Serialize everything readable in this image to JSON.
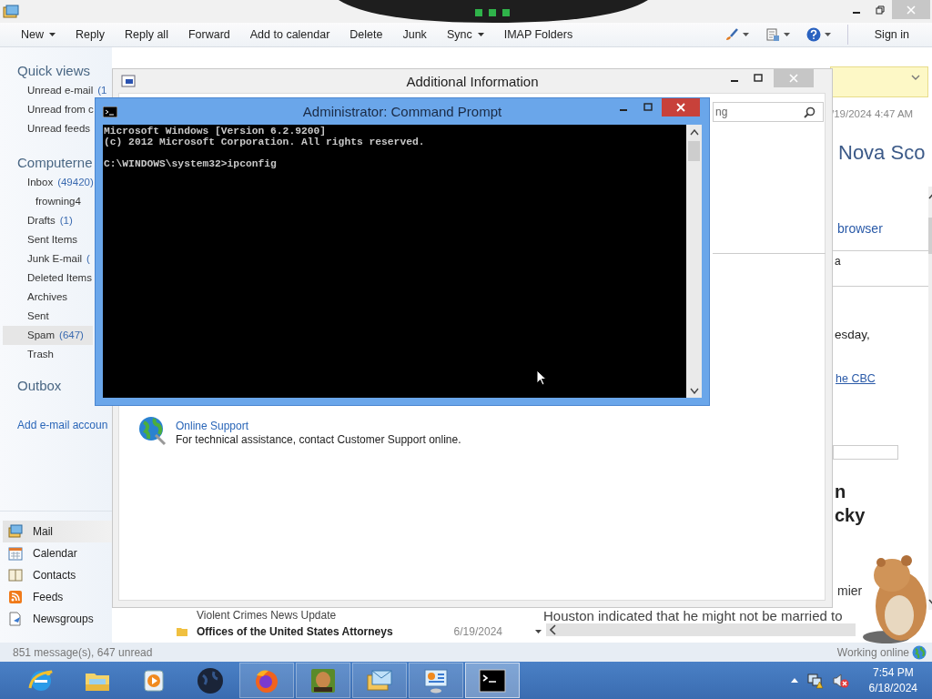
{
  "mail_window": {
    "toolbar": [
      {
        "label": "New",
        "dropdown": true
      },
      {
        "label": "Reply",
        "dropdown": false
      },
      {
        "label": "Reply all",
        "dropdown": false
      },
      {
        "label": "Forward",
        "dropdown": false
      },
      {
        "label": "Add to calendar",
        "dropdown": false
      },
      {
        "label": "Delete",
        "dropdown": false
      },
      {
        "label": "Junk",
        "dropdown": false
      },
      {
        "label": "Sync",
        "dropdown": true
      },
      {
        "label": "IMAP Folders",
        "dropdown": false
      }
    ],
    "toolbar_tools": [
      {
        "kind": "brush"
      },
      {
        "kind": "layout"
      },
      {
        "kind": "help"
      }
    ],
    "sign_in": "Sign in",
    "sidebar": {
      "quick_views": {
        "title": "Quick views",
        "items": [
          {
            "label": "Unread e-mail",
            "count": "(1"
          },
          {
            "label": "Unread from c"
          },
          {
            "label": "Unread feeds"
          }
        ]
      },
      "account": {
        "title": "Computerne",
        "folders": [
          {
            "label": "Inbox",
            "count": "(49420)",
            "selected": false,
            "children": [
              {
                "label": "frowning4",
                "selected": false
              }
            ]
          },
          {
            "label": "Drafts",
            "count": "(1)",
            "selected": false
          },
          {
            "label": "Sent Items",
            "selected": false
          },
          {
            "label": "Junk E-mail",
            "count": "(",
            "selected": false
          },
          {
            "label": "Deleted Items",
            "selected": false
          },
          {
            "label": "Archives",
            "selected": false
          },
          {
            "label": "Sent",
            "selected": false
          },
          {
            "label": "Spam",
            "count": "(647)",
            "selected": true
          },
          {
            "label": "Trash",
            "selected": false
          }
        ]
      },
      "outbox": "Outbox",
      "add_account": "Add e-mail accoun"
    },
    "nav": [
      {
        "kind": "mail",
        "label": "Mail",
        "selected": true
      },
      {
        "kind": "calendar",
        "label": "Calendar",
        "selected": false
      },
      {
        "kind": "contacts",
        "label": "Contacts",
        "selected": false
      },
      {
        "kind": "feeds",
        "label": "Feeds",
        "selected": false
      },
      {
        "kind": "newsgroups",
        "label": "Newsgroups",
        "selected": false
      }
    ],
    "message_list": {
      "preview_line": "Violent Crimes News Update",
      "next_message": {
        "sender": "Offices of the United States Attorneys",
        "date": "6/19/2024"
      }
    },
    "reading_pane": {
      "date": "/19/2024 4:47 AM",
      "title": "Nova Sco",
      "link": "browser",
      "line_1": "a",
      "line_2": "esday,",
      "link_2": "he CBC",
      "heading": [
        "n",
        "cky"
      ],
      "line_3": "mier",
      "body": "Houston indicated that he might not be married to"
    },
    "status_bar": {
      "messages": "851 message(s), 647 unread",
      "connection": "Working online"
    }
  },
  "info_window": {
    "title": "Additional Information",
    "search": {
      "value": "ng"
    },
    "support": {
      "link": "Online Support",
      "text": "For technical assistance, contact Customer Support online."
    }
  },
  "cmd_window": {
    "title": "Administrator: Command Prompt",
    "blocks": [
      [
        "Microsoft Windows [Version 6.2.9200]",
        "(c) 2012 Microsoft Corporation. All rights reserved."
      ],
      [
        "C:\\WINDOWS\\system32>ipconfig"
      ]
    ]
  },
  "taskbar": {
    "apps": [
      {
        "kind": "ie",
        "running": false,
        "selected": false
      },
      {
        "kind": "explorer",
        "running": false,
        "selected": false
      },
      {
        "kind": "media",
        "running": false,
        "selected": false
      },
      {
        "kind": "globe",
        "running": false,
        "selected": false
      },
      {
        "kind": "firefox",
        "running": true,
        "selected": false
      },
      {
        "kind": "hamster",
        "running": true,
        "selected": false
      },
      {
        "kind": "mail",
        "running": true,
        "selected": false
      },
      {
        "kind": "control",
        "running": true,
        "selected": false
      },
      {
        "kind": "cmd",
        "running": true,
        "selected": true
      }
    ],
    "clock": {
      "time": "7:54 PM",
      "date": "6/18/2024"
    }
  }
}
